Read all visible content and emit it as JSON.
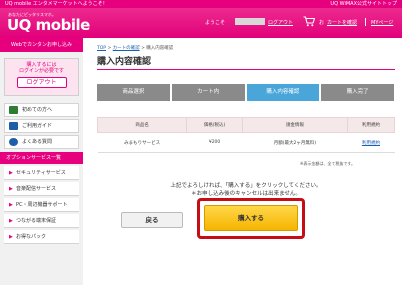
{
  "topbar": {
    "welcome": "UQ mobile エンタメマーケットへようこそ！",
    "right_link": "UQ WiMAX公式サイトトップ"
  },
  "header": {
    "tagline": "あなたにピッタリスマホ。",
    "logo": "UQ mobile",
    "welcome_prefix": "ようこそ",
    "logout": "ログアウト",
    "cart_prefix": "お",
    "cart": "カートを確認",
    "mypage": "MYページ"
  },
  "sidebar": {
    "sub_logo": "UQ mobile エンタメマーケット",
    "sub_tagline": "Webでカンタンお申し込み",
    "login_hint_1": "購入するには",
    "login_hint_2": "ログインが必要です",
    "login_hint_3": "ログインはこちら",
    "logout_button": "ログアウト",
    "menu": [
      {
        "label": "初めての方へ",
        "color": "#2e7d32"
      },
      {
        "label": "ご利用ガイド",
        "color": "#1e5fa8"
      },
      {
        "label": "よくある質問",
        "color": "#1e5fa8"
      }
    ],
    "section": "オプションサービス一覧",
    "services": [
      "セキュリティサービス",
      "音楽配信サービス",
      "PC・周辺機器サポート",
      "つながる端末保証",
      "お得なパック"
    ]
  },
  "breadcrumb": {
    "top": "TOP",
    "sep": " > ",
    "cart": "カートの確認",
    "current": "購入内容確認"
  },
  "page_title": "購入内容確認",
  "steps": [
    "商品選択",
    "カート内",
    "購入内容確認",
    "購入完了"
  ],
  "table": {
    "headers": [
      "商品名",
      "価格(税込)",
      "請金情報",
      "利用規約"
    ],
    "rows": [
      [
        "みまもりサービス",
        "¥200",
        "月額(最大2ヶ月無料)",
        "利用規約"
      ]
    ]
  },
  "note": "※表示金額は、全て税抜です。",
  "confirm": {
    "line1": "上記でよろしければ、「購入する」をクリックしてください。",
    "line2": "＊お申し込み後のキャンセルは出来ません。"
  },
  "buttons": {
    "back": "戻る",
    "buy": "購入する"
  }
}
